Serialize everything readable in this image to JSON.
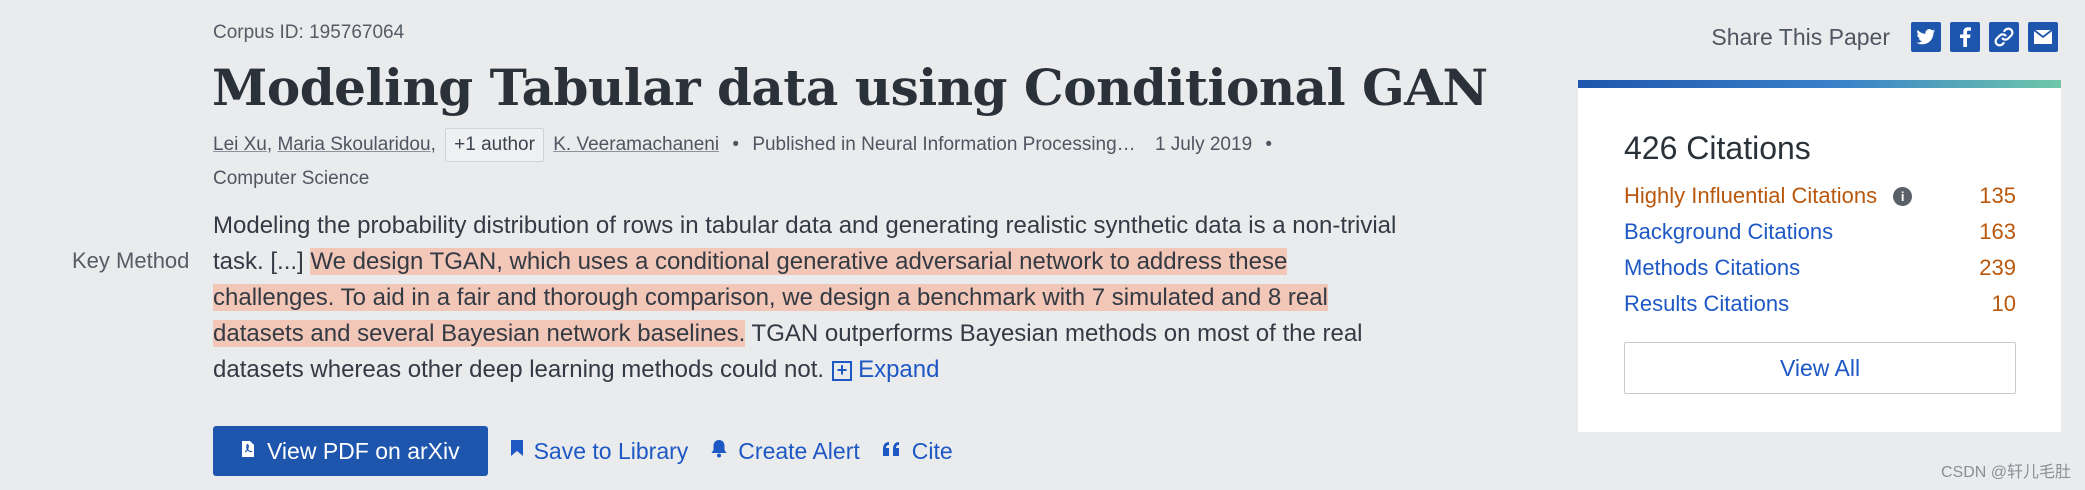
{
  "corpus_id": "Corpus ID: 195767064",
  "title": "Modeling Tabular data using Conditional GAN",
  "authors": [
    {
      "name": "Lei Xu",
      "sep": ","
    },
    {
      "name": "Maria Skoularidou",
      "sep": ","
    },
    {
      "name": "K. Veeramachaneni",
      "sep": ""
    }
  ],
  "more_authors": "+1 author",
  "published_in": "Published in Neural Information Processing…",
  "date": "1 July 2019",
  "field": "Computer Science",
  "key_method_label": "Key Method",
  "abstract": {
    "part1": "Modeling the probability distribution of rows in tabular data and generating realistic synthetic data is a non-trivial task. [...] ",
    "highlight": "We design TGAN, which uses a conditional generative adversarial network to address these challenges. To aid in a fair and thorough comparison, we design a benchmark with 7 simulated and 8 real datasets and several Bayesian network baselines.",
    "part2": " TGAN outperforms Bayesian methods on most of the real datasets whereas other deep learning methods could not.",
    "expand_label": "Expand"
  },
  "actions": {
    "view_pdf": "View PDF on arXiv",
    "save": "Save to Library",
    "alert": "Create Alert",
    "cite": "Cite"
  },
  "share": {
    "label": "Share This Paper",
    "icons": [
      "twitter-icon",
      "facebook-icon",
      "link-icon",
      "email-icon"
    ]
  },
  "citations": {
    "title": "426 Citations",
    "rows": [
      {
        "label": "Highly Influential Citations",
        "value": "135"
      },
      {
        "label": "Background Citations",
        "value": "163"
      },
      {
        "label": "Methods Citations",
        "value": "239"
      },
      {
        "label": "Results Citations",
        "value": "10"
      }
    ],
    "view_all": "View All"
  },
  "watermark": "CSDN @轩儿毛肚",
  "colors": {
    "accent": "#1f56ad",
    "link": "#1d58c4",
    "orange": "#b9580d",
    "highlight": "#f2c7b7",
    "background": "#eaebed"
  }
}
